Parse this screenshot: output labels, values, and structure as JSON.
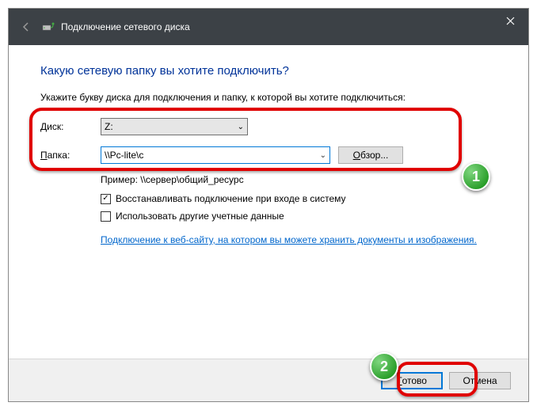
{
  "titlebar": {
    "title": "Подключение сетевого диска"
  },
  "heading": "Какую сетевую папку вы хотите подключить?",
  "instruction": "Укажите букву диска для подключения и папку, к которой вы хотите подключиться:",
  "labels": {
    "drive_prefix": "Д",
    "drive_rest": "иск:",
    "folder_prefix": "П",
    "folder_rest": "апка:"
  },
  "drive": {
    "value": "Z:"
  },
  "folder": {
    "value": "\\\\Pc-lite\\c"
  },
  "browse": {
    "prefix": "О",
    "rest": "бзор..."
  },
  "example": "Пример: \\\\сервер\\общий_ресурс",
  "checkbox_reconnect": "Восстанавливать подключение при входе в систему",
  "checkbox_othercreds": "Использовать другие учетные данные",
  "link_text": "Подключение к веб-сайту, на котором вы можете хранить документы и изображения",
  "buttons": {
    "finish_prefix": "Г",
    "finish_rest": "отово",
    "cancel": "Отмена"
  },
  "badges": {
    "one": "1",
    "two": "2"
  }
}
